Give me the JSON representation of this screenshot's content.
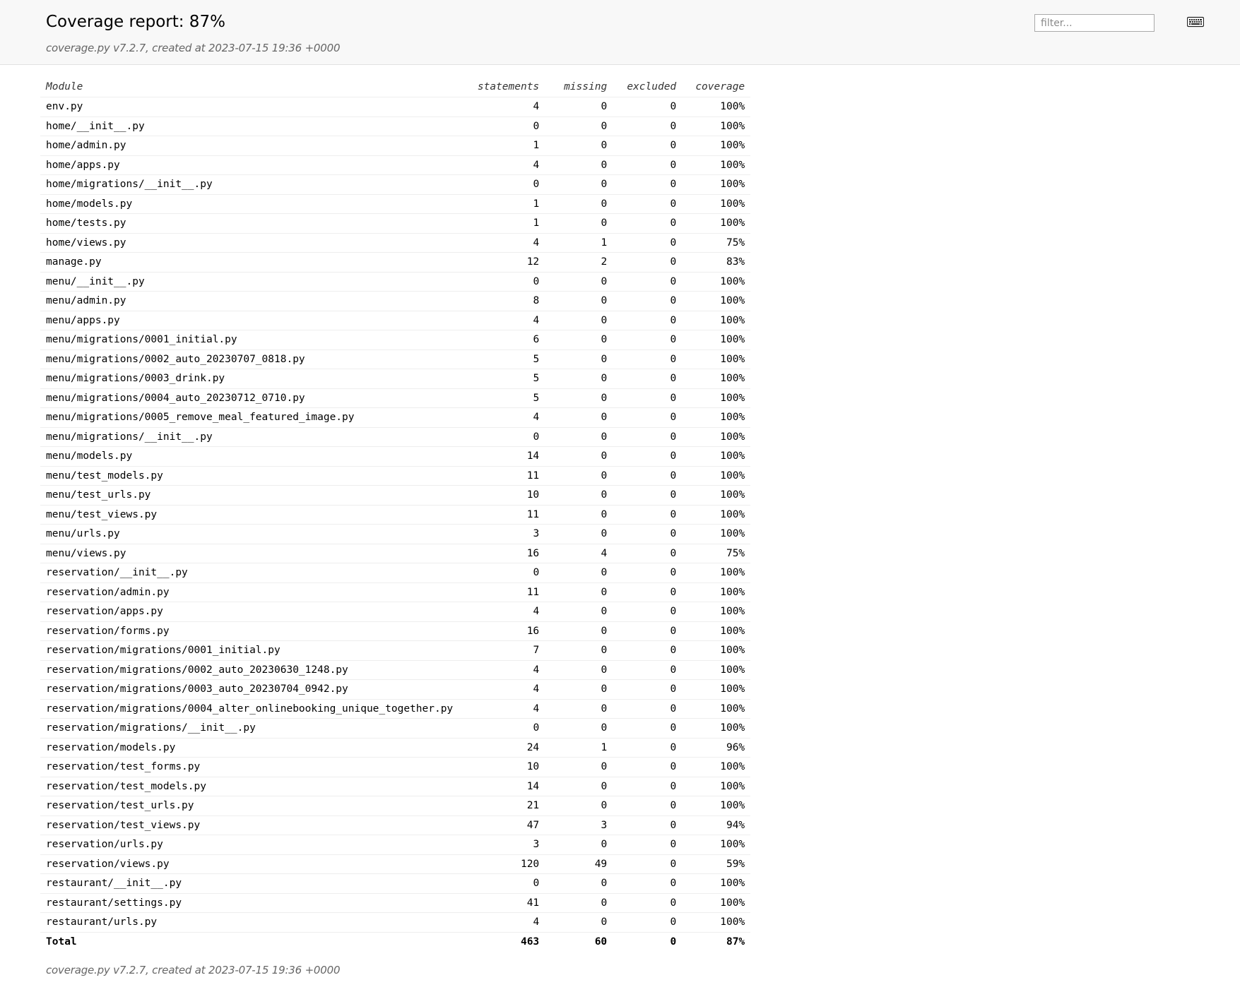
{
  "header": {
    "title": "Coverage report: 87%",
    "meta": "coverage.py v7.2.7, created at 2023-07-15 19:36 +0000",
    "filter_placeholder": "filter...",
    "keyboard_icon": "keyboard-icon"
  },
  "table": {
    "headers": {
      "module": "Module",
      "statements": "statements",
      "missing": "missing",
      "excluded": "excluded",
      "coverage": "coverage"
    },
    "rows": [
      {
        "module": "env.py",
        "statements": "4",
        "missing": "0",
        "excluded": "0",
        "coverage": "100%"
      },
      {
        "module": "home/__init__.py",
        "statements": "0",
        "missing": "0",
        "excluded": "0",
        "coverage": "100%"
      },
      {
        "module": "home/admin.py",
        "statements": "1",
        "missing": "0",
        "excluded": "0",
        "coverage": "100%"
      },
      {
        "module": "home/apps.py",
        "statements": "4",
        "missing": "0",
        "excluded": "0",
        "coverage": "100%"
      },
      {
        "module": "home/migrations/__init__.py",
        "statements": "0",
        "missing": "0",
        "excluded": "0",
        "coverage": "100%"
      },
      {
        "module": "home/models.py",
        "statements": "1",
        "missing": "0",
        "excluded": "0",
        "coverage": "100%"
      },
      {
        "module": "home/tests.py",
        "statements": "1",
        "missing": "0",
        "excluded": "0",
        "coverage": "100%"
      },
      {
        "module": "home/views.py",
        "statements": "4",
        "missing": "1",
        "excluded": "0",
        "coverage": "75%"
      },
      {
        "module": "manage.py",
        "statements": "12",
        "missing": "2",
        "excluded": "0",
        "coverage": "83%"
      },
      {
        "module": "menu/__init__.py",
        "statements": "0",
        "missing": "0",
        "excluded": "0",
        "coverage": "100%"
      },
      {
        "module": "menu/admin.py",
        "statements": "8",
        "missing": "0",
        "excluded": "0",
        "coverage": "100%"
      },
      {
        "module": "menu/apps.py",
        "statements": "4",
        "missing": "0",
        "excluded": "0",
        "coverage": "100%"
      },
      {
        "module": "menu/migrations/0001_initial.py",
        "statements": "6",
        "missing": "0",
        "excluded": "0",
        "coverage": "100%"
      },
      {
        "module": "menu/migrations/0002_auto_20230707_0818.py",
        "statements": "5",
        "missing": "0",
        "excluded": "0",
        "coverage": "100%"
      },
      {
        "module": "menu/migrations/0003_drink.py",
        "statements": "5",
        "missing": "0",
        "excluded": "0",
        "coverage": "100%"
      },
      {
        "module": "menu/migrations/0004_auto_20230712_0710.py",
        "statements": "5",
        "missing": "0",
        "excluded": "0",
        "coverage": "100%"
      },
      {
        "module": "menu/migrations/0005_remove_meal_featured_image.py",
        "statements": "4",
        "missing": "0",
        "excluded": "0",
        "coverage": "100%"
      },
      {
        "module": "menu/migrations/__init__.py",
        "statements": "0",
        "missing": "0",
        "excluded": "0",
        "coverage": "100%"
      },
      {
        "module": "menu/models.py",
        "statements": "14",
        "missing": "0",
        "excluded": "0",
        "coverage": "100%"
      },
      {
        "module": "menu/test_models.py",
        "statements": "11",
        "missing": "0",
        "excluded": "0",
        "coverage": "100%"
      },
      {
        "module": "menu/test_urls.py",
        "statements": "10",
        "missing": "0",
        "excluded": "0",
        "coverage": "100%"
      },
      {
        "module": "menu/test_views.py",
        "statements": "11",
        "missing": "0",
        "excluded": "0",
        "coverage": "100%"
      },
      {
        "module": "menu/urls.py",
        "statements": "3",
        "missing": "0",
        "excluded": "0",
        "coverage": "100%"
      },
      {
        "module": "menu/views.py",
        "statements": "16",
        "missing": "4",
        "excluded": "0",
        "coverage": "75%"
      },
      {
        "module": "reservation/__init__.py",
        "statements": "0",
        "missing": "0",
        "excluded": "0",
        "coverage": "100%"
      },
      {
        "module": "reservation/admin.py",
        "statements": "11",
        "missing": "0",
        "excluded": "0",
        "coverage": "100%"
      },
      {
        "module": "reservation/apps.py",
        "statements": "4",
        "missing": "0",
        "excluded": "0",
        "coverage": "100%"
      },
      {
        "module": "reservation/forms.py",
        "statements": "16",
        "missing": "0",
        "excluded": "0",
        "coverage": "100%"
      },
      {
        "module": "reservation/migrations/0001_initial.py",
        "statements": "7",
        "missing": "0",
        "excluded": "0",
        "coverage": "100%"
      },
      {
        "module": "reservation/migrations/0002_auto_20230630_1248.py",
        "statements": "4",
        "missing": "0",
        "excluded": "0",
        "coverage": "100%"
      },
      {
        "module": "reservation/migrations/0003_auto_20230704_0942.py",
        "statements": "4",
        "missing": "0",
        "excluded": "0",
        "coverage": "100%"
      },
      {
        "module": "reservation/migrations/0004_alter_onlinebooking_unique_together.py",
        "statements": "4",
        "missing": "0",
        "excluded": "0",
        "coverage": "100%"
      },
      {
        "module": "reservation/migrations/__init__.py",
        "statements": "0",
        "missing": "0",
        "excluded": "0",
        "coverage": "100%"
      },
      {
        "module": "reservation/models.py",
        "statements": "24",
        "missing": "1",
        "excluded": "0",
        "coverage": "96%"
      },
      {
        "module": "reservation/test_forms.py",
        "statements": "10",
        "missing": "0",
        "excluded": "0",
        "coverage": "100%"
      },
      {
        "module": "reservation/test_models.py",
        "statements": "14",
        "missing": "0",
        "excluded": "0",
        "coverage": "100%"
      },
      {
        "module": "reservation/test_urls.py",
        "statements": "21",
        "missing": "0",
        "excluded": "0",
        "coverage": "100%"
      },
      {
        "module": "reservation/test_views.py",
        "statements": "47",
        "missing": "3",
        "excluded": "0",
        "coverage": "94%"
      },
      {
        "module": "reservation/urls.py",
        "statements": "3",
        "missing": "0",
        "excluded": "0",
        "coverage": "100%"
      },
      {
        "module": "reservation/views.py",
        "statements": "120",
        "missing": "49",
        "excluded": "0",
        "coverage": "59%"
      },
      {
        "module": "restaurant/__init__.py",
        "statements": "0",
        "missing": "0",
        "excluded": "0",
        "coverage": "100%"
      },
      {
        "module": "restaurant/settings.py",
        "statements": "41",
        "missing": "0",
        "excluded": "0",
        "coverage": "100%"
      },
      {
        "module": "restaurant/urls.py",
        "statements": "4",
        "missing": "0",
        "excluded": "0",
        "coverage": "100%"
      }
    ],
    "total": {
      "module": "Total",
      "statements": "463",
      "missing": "60",
      "excluded": "0",
      "coverage": "87%"
    }
  },
  "footer": {
    "meta": "coverage.py v7.2.7, created at 2023-07-15 19:36 +0000"
  }
}
